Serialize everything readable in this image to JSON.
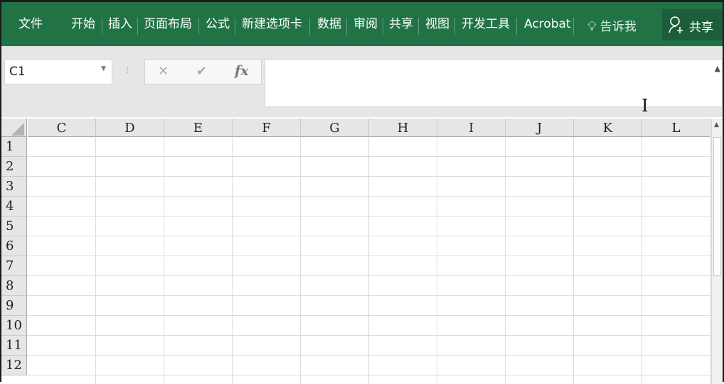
{
  "ribbon": {
    "tabs": [
      "文件",
      "开始",
      "插入",
      "页面布局",
      "公式",
      "新建选项卡",
      "数据",
      "审阅",
      "共享",
      "视图",
      "开发工具",
      "Acrobat"
    ],
    "tell_me": "告诉我",
    "share": "共享"
  },
  "formula_bar": {
    "name_box": "C1",
    "cancel": "✕",
    "enter": "✔",
    "fx": "fx",
    "value": ""
  },
  "sheet": {
    "columns": [
      "C",
      "D",
      "E",
      "F",
      "G",
      "H",
      "I",
      "J",
      "K",
      "L"
    ],
    "rows": [
      "1",
      "2",
      "3",
      "4",
      "5",
      "6",
      "7",
      "8",
      "9",
      "10",
      "11",
      "12"
    ]
  }
}
